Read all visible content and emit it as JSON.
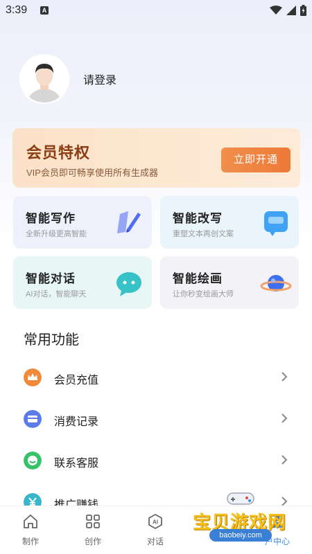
{
  "status_bar": {
    "time": "3:39",
    "app_icon_letter": "A"
  },
  "profile": {
    "login_text": "请登录"
  },
  "vip": {
    "title": "会员特权",
    "subtitle": "VIP会员即可畅享使用所有生成器",
    "button": "立即开通"
  },
  "features": [
    {
      "title": "智能写作",
      "subtitle": "全新升级更高智能",
      "icon": "pen-icon"
    },
    {
      "title": "智能改写",
      "subtitle": "重塑文本再创文案",
      "icon": "chat-bubble-blue-icon"
    },
    {
      "title": "智能对话",
      "subtitle": "AI对话，智能聊天",
      "icon": "chat-bubble-teal-icon"
    },
    {
      "title": "智能绘画",
      "subtitle": "让你秒变绘画大师",
      "icon": "planet-icon"
    }
  ],
  "common": {
    "title": "常用功能",
    "items": [
      {
        "label": "会员充值",
        "icon": "crown-icon",
        "color": "#f28a3b"
      },
      {
        "label": "消费记录",
        "icon": "card-icon",
        "color": "#5a7be8"
      },
      {
        "label": "联系客服",
        "icon": "service-icon",
        "color": "#36c36b"
      },
      {
        "label": "推广赚钱",
        "icon": "yen-icon",
        "color": "#39b6c9"
      }
    ]
  },
  "nav": [
    {
      "label": "制作",
      "icon": "home-icon"
    },
    {
      "label": "创作",
      "icon": "grid-icon"
    },
    {
      "label": "对话",
      "icon": "ai-icon"
    },
    {
      "label": "",
      "icon": "hidden"
    },
    {
      "label": "户中心",
      "icon": "user-icon"
    }
  ],
  "watermark": {
    "text": "宝贝游戏网",
    "url": "baobeiy.com"
  }
}
